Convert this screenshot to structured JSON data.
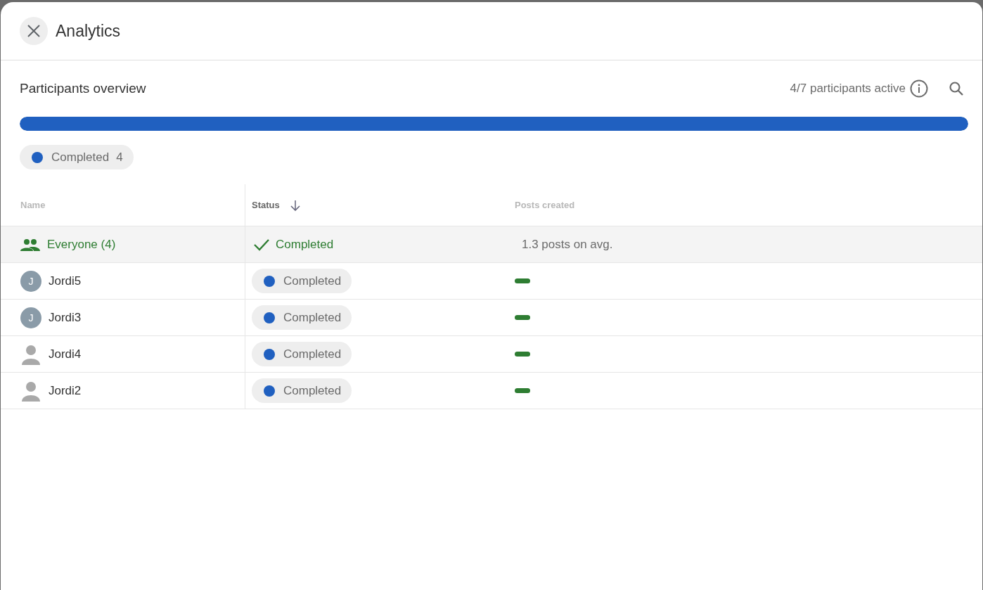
{
  "dialog": {
    "title": "Analytics"
  },
  "overview": {
    "title": "Participants overview",
    "active_text": "4/7 participants active",
    "progress": {
      "level": 1.0,
      "color": "#2060c0"
    },
    "legend": [
      {
        "label": "Completed",
        "count": "4",
        "color": "#2060c0"
      }
    ]
  },
  "table": {
    "columns": [
      {
        "label": "Name",
        "sorted": false
      },
      {
        "label": "Status",
        "sorted": true
      },
      {
        "label": "Posts created",
        "sorted": false
      }
    ],
    "summary": {
      "name": "Everyone (4)",
      "status": "Completed",
      "posts": "1.3 posts on avg."
    },
    "rows": [
      {
        "name": "Jordi5",
        "avatar": {
          "kind": "initial",
          "initial": "J"
        },
        "status": {
          "label": "Completed",
          "color": "#2060c0"
        },
        "posts_bar": true
      },
      {
        "name": "Jordi3",
        "avatar": {
          "kind": "initial",
          "initial": "J"
        },
        "status": {
          "label": "Completed",
          "color": "#2060c0"
        },
        "posts_bar": true
      },
      {
        "name": "Jordi4",
        "avatar": {
          "kind": "silhouette"
        },
        "status": {
          "label": "Completed",
          "color": "#2060c0"
        },
        "posts_bar": true
      },
      {
        "name": "Jordi2",
        "avatar": {
          "kind": "silhouette"
        },
        "status": {
          "label": "Completed",
          "color": "#2060c0"
        },
        "posts_bar": true
      }
    ]
  }
}
